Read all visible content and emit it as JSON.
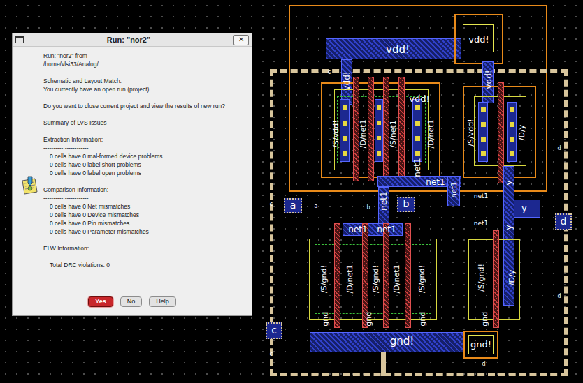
{
  "dialog": {
    "title": "Run: \"nor2\"",
    "close": "✕",
    "sections": [
      {
        "lines": [
          {
            "text": "Run: \"nor2\"  from",
            "kind": "plain"
          },
          {
            "text": "/home/vlsi33/Analog/",
            "kind": "plain"
          }
        ]
      },
      {
        "lines": [
          {
            "text": "Schematic and Layout Match.",
            "kind": "plain"
          },
          {
            "text": "You currently have an open run (project).",
            "kind": "plain"
          }
        ]
      },
      {
        "lines": [
          {
            "text": "Do you want to close current project and view the results of new run?",
            "kind": "plain"
          }
        ]
      },
      {
        "lines": [
          {
            "text": "Summary of LVS Issues",
            "kind": "plain"
          }
        ]
      },
      {
        "lines": [
          {
            "text": "Extraction Information:",
            "kind": "plain"
          },
          {
            "text": "---------- ------------",
            "kind": "plain"
          },
          {
            "text": "0 cells have 0 mal-formed device problems",
            "kind": "item"
          },
          {
            "text": "0 cells have 0 label short problems",
            "kind": "item"
          },
          {
            "text": "0 cells have 0 label open problems",
            "kind": "item"
          }
        ]
      },
      {
        "lines": [
          {
            "text": "Comparison Information:",
            "kind": "plain"
          },
          {
            "text": "---------- ------------",
            "kind": "plain"
          },
          {
            "text": "0 cells have 0 Net mismatches",
            "kind": "item"
          },
          {
            "text": "0 cells have 0 Device mismatches",
            "kind": "item"
          },
          {
            "text": "0 cells have 0 Pin mismatches",
            "kind": "item"
          },
          {
            "text": "0 cells have 0 Parameter mismatches",
            "kind": "item"
          }
        ]
      },
      {
        "lines": [
          {
            "text": "ELW Information:",
            "kind": "plain"
          },
          {
            "text": "---------- ------------",
            "kind": "plain"
          },
          {
            "text": "Total DRC violations: 0",
            "kind": "item"
          }
        ]
      }
    ],
    "buttons": [
      {
        "label": "Yes",
        "selected": true
      },
      {
        "label": "No",
        "selected": false
      },
      {
        "label": "Help",
        "selected": false
      }
    ]
  },
  "layout": {
    "labels": [
      "vdd!",
      "vdd!",
      "vdd!",
      "vdd!",
      "/S/vdd!",
      "/D/net1",
      "/S/net1",
      "/D/net1",
      "vdd!",
      "/S/vdd!",
      "/D/y",
      "net1",
      "net1",
      "net1",
      "net1",
      "net1",
      "y",
      "a",
      "b",
      "y",
      "d",
      "c",
      "net1",
      "net1",
      "net1",
      "y",
      "/S/gnd!",
      "/D/net1",
      "/S/gnd!",
      "/D/net1",
      "/S/gnd!",
      "/S/gnd!",
      "/D/y",
      "gnd!",
      "gnd!",
      "gnd!",
      "gnd!",
      "gnd!",
      "gnd!",
      "c",
      "a",
      "b",
      "d",
      "d",
      "c",
      "c",
      "d"
    ]
  }
}
